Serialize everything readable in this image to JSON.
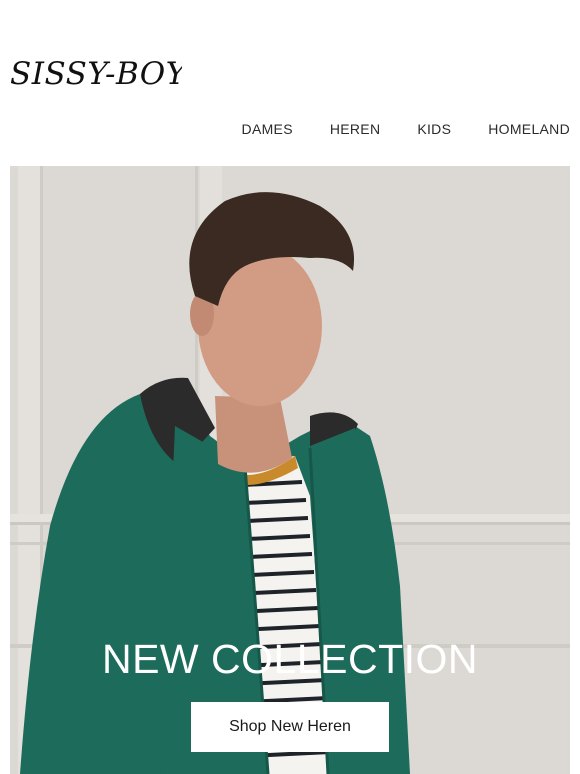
{
  "brand": {
    "logo_text": "SISSY-BOY"
  },
  "nav": {
    "items": [
      {
        "label": "DAMES"
      },
      {
        "label": "HEREN"
      },
      {
        "label": "KIDS"
      },
      {
        "label": "HOMELAND"
      }
    ]
  },
  "hero": {
    "title": "NEW COLLECTION",
    "cta_label": "Shop New Heren"
  },
  "colors": {
    "jacket": "#1d6b5a",
    "wall": "#dcd9d4",
    "text": "#1a1a1a"
  }
}
